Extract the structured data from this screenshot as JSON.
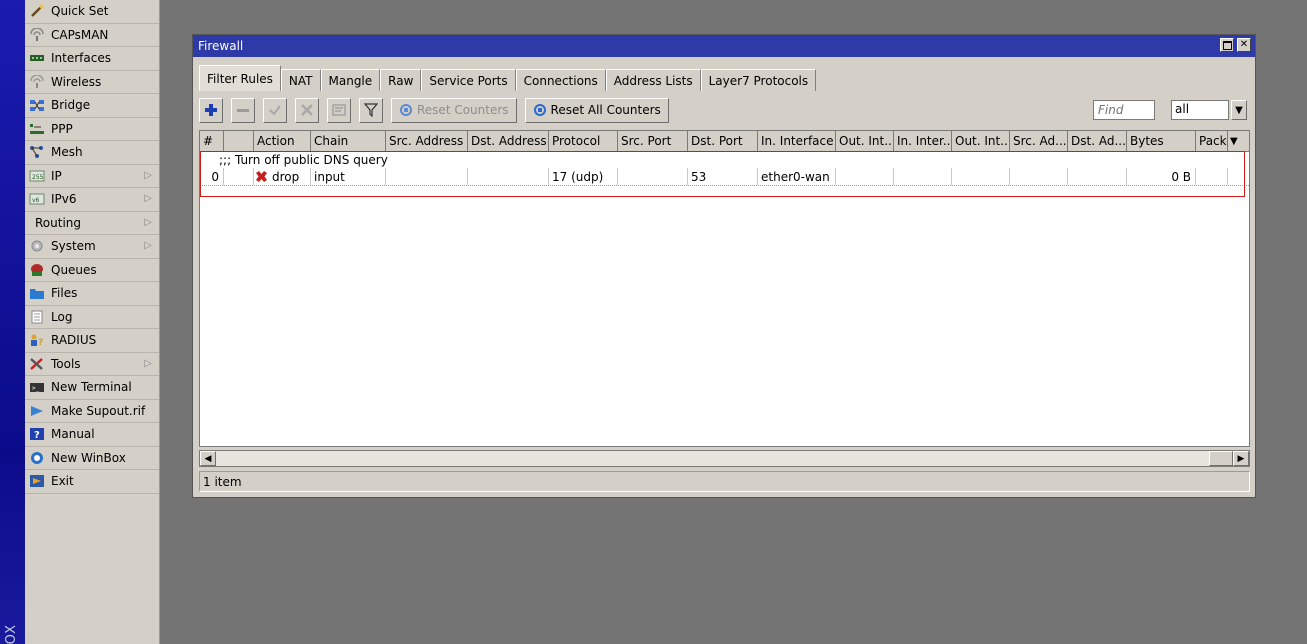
{
  "brand": {
    "text": "OX"
  },
  "sidebar": {
    "items": [
      {
        "label": "Quick Set",
        "icon": "wand-icon",
        "has_submenu": false
      },
      {
        "label": "CAPsMAN",
        "icon": "capsman-icon",
        "has_submenu": false
      },
      {
        "label": "Interfaces",
        "icon": "interfaces-icon",
        "has_submenu": false
      },
      {
        "label": "Wireless",
        "icon": "wireless-icon",
        "has_submenu": false
      },
      {
        "label": "Bridge",
        "icon": "bridge-icon",
        "has_submenu": false
      },
      {
        "label": "PPP",
        "icon": "ppp-icon",
        "has_submenu": false
      },
      {
        "label": "Mesh",
        "icon": "mesh-icon",
        "has_submenu": false
      },
      {
        "label": "IP",
        "icon": "ip-icon",
        "has_submenu": true
      },
      {
        "label": "IPv6",
        "icon": "ipv6-icon",
        "has_submenu": true
      },
      {
        "label": "Routing",
        "icon": "",
        "has_submenu": true
      },
      {
        "label": "System",
        "icon": "gear-icon",
        "has_submenu": true
      },
      {
        "label": "Queues",
        "icon": "queues-icon",
        "has_submenu": false
      },
      {
        "label": "Files",
        "icon": "folder-icon",
        "has_submenu": false
      },
      {
        "label": "Log",
        "icon": "log-icon",
        "has_submenu": false
      },
      {
        "label": "RADIUS",
        "icon": "radius-icon",
        "has_submenu": false
      },
      {
        "label": "Tools",
        "icon": "tools-icon",
        "has_submenu": true
      },
      {
        "label": "New Terminal",
        "icon": "terminal-icon",
        "has_submenu": false
      },
      {
        "label": "Make Supout.rif",
        "icon": "supout-icon",
        "has_submenu": false
      },
      {
        "label": "Manual",
        "icon": "manual-icon",
        "has_submenu": false
      },
      {
        "label": "New WinBox",
        "icon": "winbox-icon",
        "has_submenu": false
      },
      {
        "label": "Exit",
        "icon": "exit-icon",
        "has_submenu": false
      }
    ]
  },
  "window": {
    "title": "Firewall",
    "tabs": [
      {
        "label": "Filter Rules",
        "active": true
      },
      {
        "label": "NAT",
        "active": false
      },
      {
        "label": "Mangle",
        "active": false
      },
      {
        "label": "Raw",
        "active": false
      },
      {
        "label": "Service Ports",
        "active": false
      },
      {
        "label": "Connections",
        "active": false
      },
      {
        "label": "Address Lists",
        "active": false
      },
      {
        "label": "Layer7 Protocols",
        "active": false
      }
    ],
    "toolbar": {
      "reset_counters": "Reset Counters",
      "reset_all_counters": "Reset All Counters",
      "find_placeholder": "Find",
      "filter_value": "all"
    },
    "table": {
      "columns": [
        "#",
        "Action",
        "Chain",
        "Src. Address",
        "Dst. Address",
        "Protocol",
        "Src. Port",
        "Dst. Port",
        "In. Interface",
        "Out. Int...",
        "In. Inter...",
        "Out. Int...",
        "Src. Ad...",
        "Dst. Ad...",
        "Bytes",
        "Packe"
      ],
      "comment": ";;; Turn off public DNS query",
      "rows": [
        {
          "num": "0",
          "action": "drop",
          "chain": "input",
          "src_address": "",
          "dst_address": "",
          "protocol": "17 (udp)",
          "src_port": "",
          "dst_port": "53",
          "in_interface": "ether0-wan",
          "out_int": "",
          "in_inter": "",
          "out_int2": "",
          "src_ad": "",
          "dst_ad": "",
          "bytes": "0 B",
          "packets": ""
        }
      ]
    },
    "status": "1 item"
  },
  "colors": {
    "titlebar": "#2e3aa8",
    "desktop": "#747474",
    "panel": "#d4d0c8",
    "highlight": "#d21c1c",
    "drop_icon": "#c81e1e",
    "add_icon": "#1c3fb5"
  }
}
